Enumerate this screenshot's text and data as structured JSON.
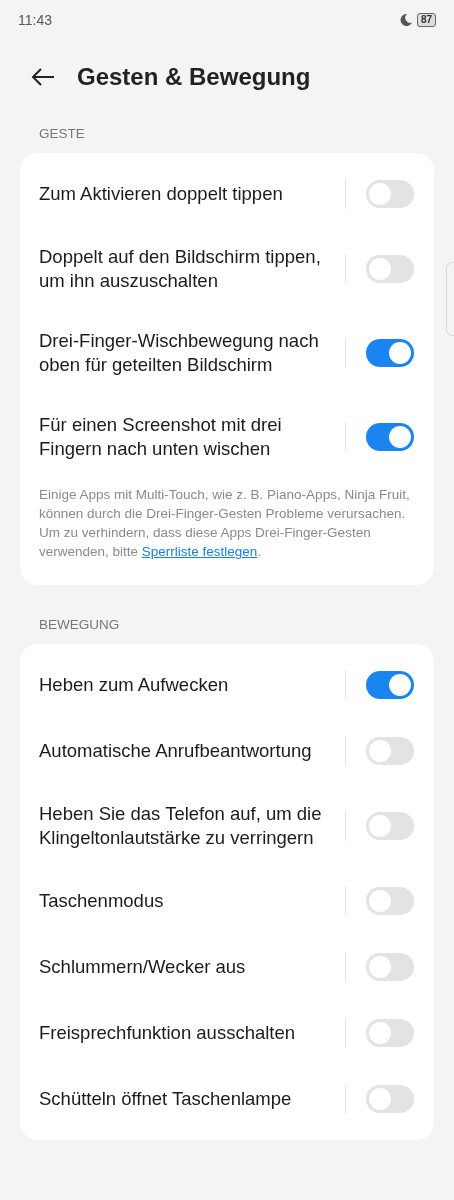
{
  "status_bar": {
    "time": "11:43",
    "battery": "87"
  },
  "header": {
    "title": "Gesten & Bewegung"
  },
  "sections": [
    {
      "title": "GESTE",
      "rows": [
        {
          "label": "Zum Aktivieren doppelt tippen",
          "on": false
        },
        {
          "label": "Doppelt auf den Bildschirm tippen, um ihn auszuschalten",
          "on": false
        },
        {
          "label": "Drei-Finger-Wischbewegung nach oben für geteilten Bildschirm",
          "on": true
        },
        {
          "label": "Für einen Screenshot mit drei Fingern nach unten wischen",
          "on": true
        }
      ],
      "note": {
        "text": "Einige Apps mit Multi-Touch, wie z. B. Piano-Apps, Ninja Fruit, können durch die Drei-Finger-Gesten Probleme verursachen. Um zu verhindern, dass diese Apps Drei-Finger-Gesten verwenden, bitte ",
        "link": "Sperrliste festlegen",
        "after": "."
      }
    },
    {
      "title": "BEWEGUNG",
      "rows": [
        {
          "label": "Heben zum Aufwecken",
          "on": true
        },
        {
          "label": "Automatische Anrufbeantwortung",
          "on": false
        },
        {
          "label": "Heben Sie das Telefon auf, um die Klingeltonlautstärke zu verringern",
          "on": false
        },
        {
          "label": "Taschenmodus",
          "on": false
        },
        {
          "label": "Schlummern/Wecker aus",
          "on": false
        },
        {
          "label": "Freisprechfunktion ausschalten",
          "on": false
        },
        {
          "label": "Schütteln öffnet Taschenlampe",
          "on": false
        }
      ]
    }
  ]
}
